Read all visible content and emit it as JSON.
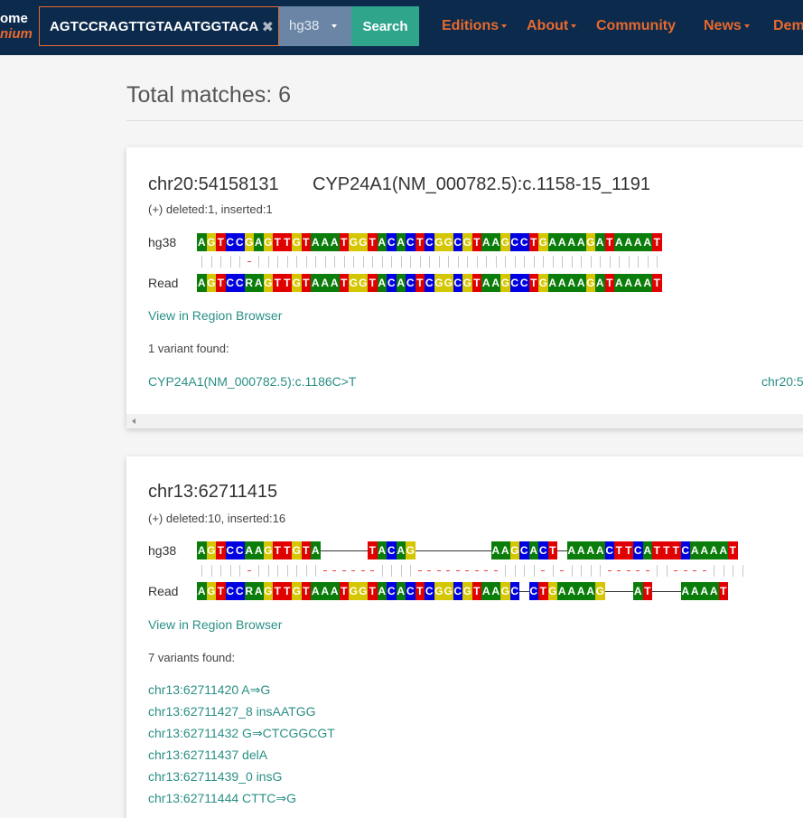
{
  "brand": {
    "line1": "ome",
    "line2": "nium"
  },
  "search": {
    "query": "AGTCCRAGTTGTAAATGGTACA",
    "clear_symbol": "✖",
    "build": "hg38",
    "button": "Search"
  },
  "nav": {
    "editions": "Editions",
    "about": "About",
    "community": "Community",
    "news": "News",
    "demo": "Dem"
  },
  "results": {
    "total": "Total matches: 6"
  },
  "matches": [
    {
      "location": "chr20:54158131",
      "hgvs": "CYP24A1(NM_000782.5):c.1158-15_1191",
      "indel": "(+) deleted:1, inserted:1",
      "ref_label": "hg38",
      "read_label": "Read",
      "ref_seq": "AGTCCGAGTTGTAAATGGTACACTCGGCGTAAGCCTGAAAAGATAAAAT",
      "match_line": "|||||-|||||||||||||||||||||||||||||||||||||||||||",
      "read_seq": "AGTCCRAGTTGTAAATGGTACACTCGGCGTAAGCCTGAAAAGATAAAAT",
      "region_link": "View in Region Browser",
      "variant_count": "1 variant found:",
      "variants": [
        "CYP24A1(NM_000782.5):c.1186C>T"
      ],
      "variant_right": "chr20:5"
    },
    {
      "location": "chr13:62711415",
      "indel": "(+) deleted:10, inserted:16",
      "ref_label": "hg38",
      "read_label": "Read",
      "ref_seq": "AGTCCAAGTTGTA-----TACAG--------AAGCACT-AAAACTTCATTTCAAAAT",
      "match_line": "|||||-|||||||------||||---------||||-|-||||-----||----||||",
      "read_seq": "AGTCCRAGTTGTAAATGGTACACTCGGCGTAAGC-CTGAAAAG---AT---AAAAT",
      "region_link": "View in Region Browser",
      "variant_count": "7 variants found:",
      "variants": [
        "chr13:62711420 A⇒G",
        "chr13:62711427_8 insAATGG",
        "chr13:62711432 G⇒CTCGGCGT",
        "chr13:62711437 delA",
        "chr13:62711439_0 insG",
        "chr13:62711444 CTTC⇒G"
      ]
    }
  ],
  "colors": {
    "navbar": "#0b2a4c",
    "accent": "#e8692c",
    "search_button": "#2fa58c",
    "link": "#2a8f86",
    "base_A": "#0b7d0b",
    "base_G": "#d4c600",
    "base_C": "#0000e0",
    "base_T": "#e00000"
  }
}
